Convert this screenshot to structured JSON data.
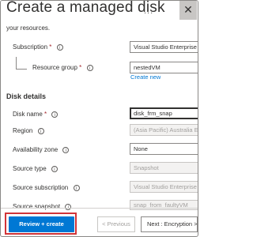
{
  "header": {
    "title": "Create a managed disk",
    "more": "...",
    "close": "✕"
  },
  "intro": {
    "text": "your resources."
  },
  "subscription": {
    "label": "Subscription",
    "required": "*",
    "value": "Visual Studio Enterprise"
  },
  "resource_group": {
    "label": "Resource group",
    "required": "*",
    "value": "nestedVM",
    "create_new": "Create new"
  },
  "disk_details": {
    "heading": "Disk details"
  },
  "disk_name": {
    "label": "Disk name",
    "required": "*",
    "value": "disk_frm_snap"
  },
  "region": {
    "label": "Region",
    "value": "(Asia Pacific) Australia East"
  },
  "availability_zone": {
    "label": "Availability zone",
    "value": "None"
  },
  "source_type": {
    "label": "Source type",
    "value": "Snapshot"
  },
  "source_subscription": {
    "label": "Source subscription",
    "value": "Visual Studio Enterprise"
  },
  "source_snapshot": {
    "label": "Source snapshot",
    "value": "snap_from_faultyVM"
  },
  "footer": {
    "review_create": "Review + create",
    "previous": "< Previous",
    "next": "Next : Encryption >"
  }
}
